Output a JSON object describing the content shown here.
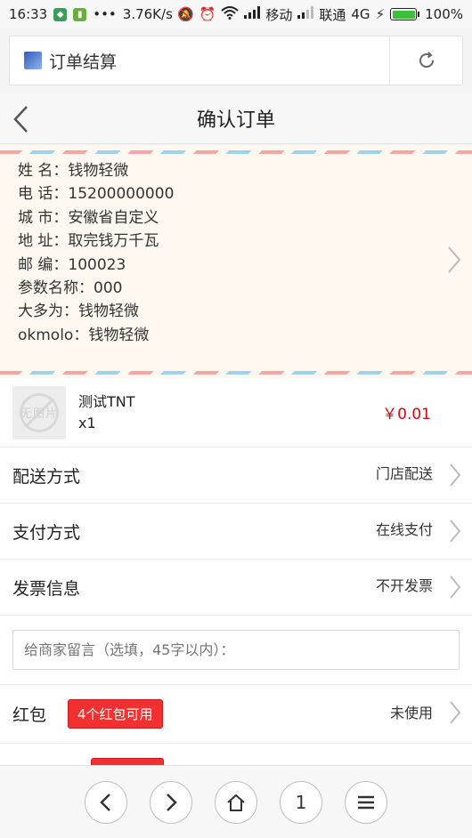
{
  "status_bar": {
    "time": "16:33",
    "speed": "3.76K/s",
    "carrier1": "移动",
    "carrier2": "联通",
    "network": "4G",
    "battery": "100%"
  },
  "browser": {
    "tab_title": "订单结算"
  },
  "header": {
    "title": "确认订单"
  },
  "address": {
    "lines": [
      "姓 名：钱物轻微",
      "电 话：15200000000",
      "城 市：安徽省自定义",
      "地 址：取完钱万千瓦",
      "邮 编：100023",
      "参数名称：000",
      "大多为：钱物轻微",
      "okmolo：钱物轻微"
    ]
  },
  "product": {
    "thumb_text": "无图片",
    "name": "测试TNT",
    "qty": "x1",
    "price": "￥0.01"
  },
  "options": [
    {
      "label": "配送方式",
      "value": "门店配送"
    },
    {
      "label": "支付方式",
      "value": "在线支付"
    },
    {
      "label": "发票信息",
      "value": "不开发票"
    }
  ],
  "message": {
    "placeholder": "给商家留言（选填，45字以内）："
  },
  "redpack": {
    "label": "红包",
    "badge": "4个红包可用",
    "value": "未使用"
  },
  "bottom_nav": {
    "tabs_count": "1"
  }
}
